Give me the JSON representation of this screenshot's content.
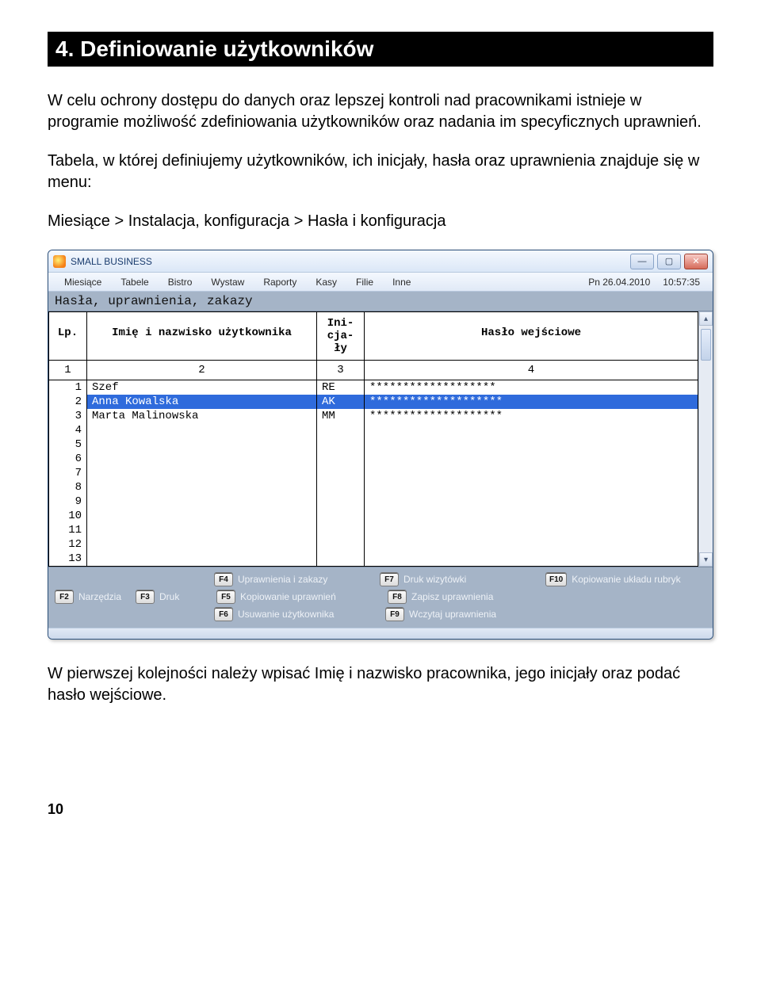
{
  "heading": "4. Definiowanie użytkowników",
  "para1": "W celu ochrony dostępu do danych oraz lepszej kontroli nad pracownikami istnieje w programie możliwość zdefiniowania użytkowników oraz nadania im specyficznych uprawnień.",
  "para2": "Tabela, w której definiujemy użytkowników, ich inicjały, hasła oraz uprawnienia znajduje się w menu:",
  "para3": "Miesiące > Instalacja, konfiguracja > Hasła i konfiguracja",
  "para4": "W pierwszej kolejności należy wpisać Imię i nazwisko pracownika, jego inicjały oraz podać hasło wejściowe.",
  "pagenum": "10",
  "window": {
    "title": "SMALL BUSINESS",
    "menus": [
      "Miesiące",
      "Tabele",
      "Bistro",
      "Wystaw",
      "Raporty",
      "Kasy",
      "Filie",
      "Inne"
    ],
    "date": "Pn 26.04.2010",
    "time": "10:57:35",
    "subheader": "Hasła, uprawnienia, zakazy",
    "columns": {
      "h1": "Lp.",
      "h2": "Imię i nazwisko użytkownika",
      "h3": "Ini-\ncja-\nły",
      "h4": "Hasło wejściowe",
      "n1": "1",
      "n2": "2",
      "n3": "3",
      "n4": "4"
    },
    "rows": [
      {
        "lp": "1",
        "name": "Szef",
        "ini": "RE",
        "pass": "*******************",
        "selected": false
      },
      {
        "lp": "2",
        "name": "Anna Kowalska",
        "ini": "AK",
        "pass": "********************",
        "selected": true
      },
      {
        "lp": "3",
        "name": "Marta Malinowska",
        "ini": "MM",
        "pass": "********************",
        "selected": false
      },
      {
        "lp": "4",
        "name": "",
        "ini": "",
        "pass": "",
        "selected": false
      },
      {
        "lp": "5",
        "name": "",
        "ini": "",
        "pass": "",
        "selected": false
      },
      {
        "lp": "6",
        "name": "",
        "ini": "",
        "pass": "",
        "selected": false
      },
      {
        "lp": "7",
        "name": "",
        "ini": "",
        "pass": "",
        "selected": false
      },
      {
        "lp": "8",
        "name": "",
        "ini": "",
        "pass": "",
        "selected": false
      },
      {
        "lp": "9",
        "name": "",
        "ini": "",
        "pass": "",
        "selected": false
      },
      {
        "lp": "10",
        "name": "",
        "ini": "",
        "pass": "",
        "selected": false
      },
      {
        "lp": "11",
        "name": "",
        "ini": "",
        "pass": "",
        "selected": false
      },
      {
        "lp": "12",
        "name": "",
        "ini": "",
        "pass": "",
        "selected": false
      },
      {
        "lp": "13",
        "name": "",
        "ini": "",
        "pass": "",
        "selected": false
      }
    ],
    "fn": {
      "f2": "Narzędzia",
      "f3": "Druk",
      "f4": "Uprawnienia i zakazy",
      "f5": "Kopiowanie uprawnień",
      "f6": "Usuwanie użytkownika",
      "f7": "Druk wizytówki",
      "f8": "Zapisz uprawnienia",
      "f9": "Wczytaj uprawnienia",
      "f10": "Kopiowanie układu rubryk",
      "k2": "F2",
      "k3": "F3",
      "k4": "F4",
      "k5": "F5",
      "k6": "F6",
      "k7": "F7",
      "k8": "F8",
      "k9": "F9",
      "k10": "F10"
    }
  }
}
